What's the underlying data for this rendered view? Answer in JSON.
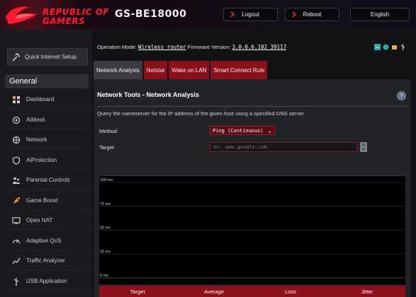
{
  "header": {
    "brand_line1": "REPUBLIC OF",
    "brand_line2": "GAMERS",
    "model": "GS-BE18000",
    "logout_label": "Logout",
    "reboot_label": "Reboot",
    "language": "English",
    "brand_color": "#ff1b2d"
  },
  "sidebar": {
    "quick_setup_label": "Quick Internet Setup",
    "section_header": "General",
    "items": [
      {
        "label": "Dashboard",
        "icon": "dashboard-icon"
      },
      {
        "label": "AiMesh",
        "icon": "aimesh-icon"
      },
      {
        "label": "Network",
        "icon": "network-icon"
      },
      {
        "label": "AiProtection",
        "icon": "aiprotection-icon"
      },
      {
        "label": "Parental Controls",
        "icon": "parental-controls-icon"
      },
      {
        "label": "Game Boost",
        "icon": "game-boost-icon"
      },
      {
        "label": "Open NAT",
        "icon": "open-nat-icon"
      },
      {
        "label": "Adaptive QoS",
        "icon": "adaptive-qos-icon"
      },
      {
        "label": "Traffic Analyzer",
        "icon": "traffic-analyzer-icon"
      },
      {
        "label": "USB Application",
        "icon": "usb-application-icon"
      }
    ]
  },
  "status": {
    "op_mode_label": "Operation Mode:",
    "op_mode_value": "Wireless router",
    "firmware_label": "Firmware Version:",
    "firmware_value": "3.0.0.6.102_39117"
  },
  "tabs": [
    {
      "label": "Network Analysis",
      "active": true
    },
    {
      "label": "Netstat",
      "active": false
    },
    {
      "label": "Wake on LAN",
      "active": false
    },
    {
      "label": "Smart Connect Rule",
      "active": false
    }
  ],
  "panel": {
    "title": "Network Tools - Network Analysis",
    "description": "Query the nameserver for the IP address of the given host using a specified DNS server.",
    "method_label": "Method",
    "method_value": "Ping (Continuous)",
    "target_label": "Target",
    "target_placeholder": "ex: www.google.com",
    "target_value": ""
  },
  "chart_data": {
    "type": "line",
    "y_ticks": [
      "100 ms",
      "75 ms",
      "50 ms",
      "25 ms",
      "0 ms"
    ],
    "ylim": [
      0,
      100
    ],
    "series": []
  },
  "results": {
    "columns": [
      "Target",
      "Average",
      "Loss",
      "Jitter"
    ],
    "rows": []
  },
  "colors": {
    "accent": "#8c0f1c",
    "panel_bg": "#222326",
    "sidebar_bg": "#1a1b1e"
  }
}
